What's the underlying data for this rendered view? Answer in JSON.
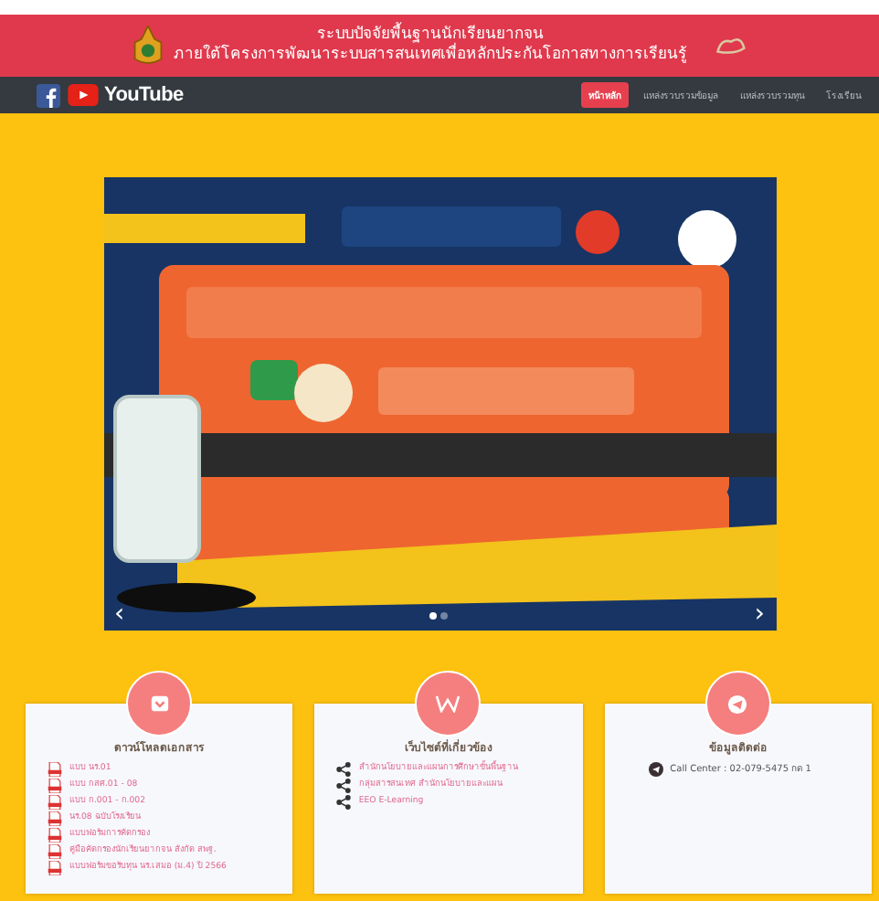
{
  "header": {
    "title": "ระบบปัจจัยพื้นฐานนักเรียนยากจน",
    "subtitle": "ภายใต้โครงการพัฒนาระบบสารสนเทศเพื่อหลักประกันโอกาสทางการเรียนรู้"
  },
  "navbar": {
    "brand": "YouTube",
    "items": [
      {
        "label": "หน้าหลัก",
        "selected": true
      },
      {
        "label": "แหล่งรวบรวมข้อมูล",
        "selected": false
      },
      {
        "label": "แหล่งรวบรวมทุน",
        "selected": false
      },
      {
        "label": "โรงเรียน",
        "selected": false
      }
    ]
  },
  "carousel": {
    "prev": "‹",
    "next": "›",
    "indicators": [
      {
        "selected": true
      },
      {
        "selected": false
      }
    ]
  },
  "cards": [
    {
      "kind": "download",
      "title": "ดาวน์โหลดเอกสาร",
      "links": [
        "แบบ นร.01",
        "แบบ กสศ.01 - 08",
        "แบบ ก.001 - ก.002",
        "นร.08 ฉบับโรงเรียน",
        "แบบฟอร์มการคัดกรอง",
        "คู่มือคัดกรองนักเรียนยากจน สังกัด สพฐ.",
        "แบบฟอร์มขอรับทุน นร.เสมอ (ม.4) ปี 2566"
      ]
    },
    {
      "kind": "web",
      "title": "เว็บไซต์ที่เกี่ยวข้อง",
      "links": [
        "สำนักนโยบายและแผนการศึกษาขั้นพื้นฐาน",
        "กลุ่มสารสนเทศ สำนักนโยบายและแผน",
        "EEO E-Learning"
      ]
    },
    {
      "kind": "contact",
      "title": "ข้อมูลติดต่อ",
      "links": [
        "Call Center : 02-079-5475 กด 1"
      ]
    }
  ]
}
